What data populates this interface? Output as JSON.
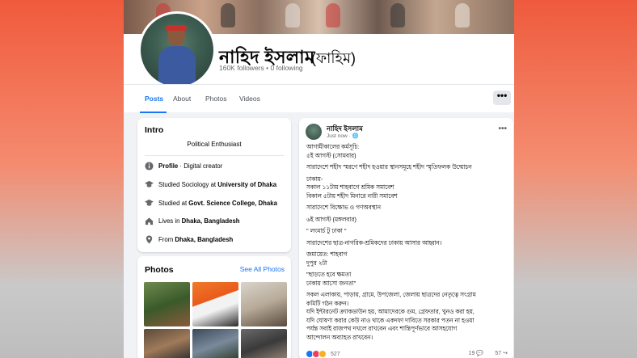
{
  "profile": {
    "name": "নাহিদ ইসলাম",
    "alias": "(ফাহিম)",
    "followers": "160K followers",
    "following": "0 following",
    "separator": "•"
  },
  "tabs": [
    "Posts",
    "About",
    "Photos",
    "Videos"
  ],
  "more_label": "•••",
  "intro": {
    "title": "Intro",
    "bio": "Political Enthusiast",
    "rows": [
      {
        "icon": "info-icon",
        "parts": [
          "Profile",
          " · Digital creator"
        ]
      },
      {
        "icon": "graduation-cap-icon",
        "parts": [
          "Studied Sociology at ",
          "University of Dhaka"
        ]
      },
      {
        "icon": "graduation-cap-icon",
        "parts": [
          "Studied at ",
          "Govt. Science College, Dhaka"
        ]
      },
      {
        "icon": "home-icon",
        "parts": [
          "Lives in ",
          "Dhaka, Bangladesh"
        ]
      },
      {
        "icon": "location-pin-icon",
        "parts": [
          "From ",
          "Dhaka, Bangladesh"
        ]
      }
    ]
  },
  "photos": {
    "title": "Photos",
    "see_all": "See All Photos"
  },
  "post": {
    "author": "নাহিদ ইসলাম",
    "time": "Just now",
    "privacy": "· 🌐",
    "more": "•••",
    "lines": [
      "আগামীকালের কর্মসূচি:",
      "৫ই আগস্ট (সোমবার)",
      "",
      "সারাদেশে শহীদ স্মরণে শহীদ হওয়ার স্থানসমূহে শহীদ স্মৃতিফলক উন্মোচন",
      "",
      "ঢাকায়-",
      "সকাল ১১টায় শাহবাগে শ্রমিক সমাবেশ",
      "বিকাল ৫টায় শহীদ মিনারে নারী সমাবেশ",
      "",
      "সারাদেশে বিক্ষোভ ও গণঅবস্থান",
      "",
      "৬ই আগস্ট (মঙ্গলবার)",
      "",
      "\" লংমার্চ টু ঢাকা \"",
      "",
      "সারাদেশের ছাত্র-নাগরিক-শ্রমিকদের ঢাকায় আসার আহ্বান।",
      "",
      "জমায়েত: শাহবাগ",
      "দুপুর ২টা",
      "",
      "\"ছাড়তে হবে ক্ষমতা",
      "ঢাকায় আসো জনতা\"",
      "",
      "সকল এলাকায়, পাড়ায়, গ্রামে, উপজেলা, জেলায় ছাত্রদের নেতৃত্বে সংগ্রাম",
      "কমিটি গঠন করুন।",
      "যদি ইন্টারনেট ক্র্যাকডাউন হয়, আমাদেরকে গুম, গ্রেফতার, খুনও করা হয়,",
      "যদি ঘোষণা করার কেউ নাও থাকে একদফা দাবিতে সরকার পতন না হওয়া",
      "পর্যন্ত সবাই রাজপথ দখলে রাখবেন এবং শান্তিপূর্ণভাবে আসহযোগ",
      "আন্দোলন অব্যাহত রাখবেন।"
    ],
    "reactions_count": "527",
    "comments": "19 💬",
    "shares": "57 ↪"
  },
  "colors": {
    "accent": "#1877f2",
    "text": "#050505",
    "muted": "#65676b"
  }
}
